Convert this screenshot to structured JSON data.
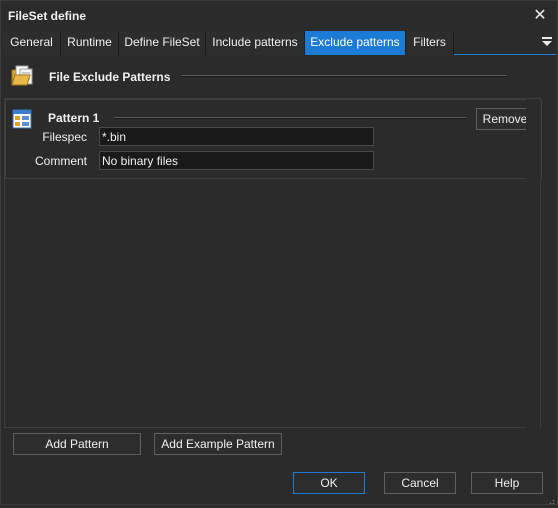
{
  "window": {
    "title": "FileSet define"
  },
  "tabs": [
    {
      "label": "General",
      "active": false
    },
    {
      "label": "Runtime",
      "active": false
    },
    {
      "label": "Define FileSet",
      "active": false
    },
    {
      "label": "Include patterns",
      "active": false
    },
    {
      "label": "Exclude patterns",
      "active": true
    },
    {
      "label": "Filters",
      "active": false
    }
  ],
  "section": {
    "title": "File Exclude Patterns",
    "icon": "folder-documents-icon"
  },
  "patterns": [
    {
      "title": "Pattern 1",
      "icon": "pattern-list-icon",
      "remove_label": "Remove",
      "filespec_label": "Filespec",
      "filespec_value": "*.bin",
      "comment_label": "Comment",
      "comment_value": "No binary files"
    }
  ],
  "actions": {
    "add_pattern": "Add Pattern",
    "add_example_pattern": "Add Example Pattern"
  },
  "footer": {
    "ok": "OK",
    "cancel": "Cancel",
    "help": "Help"
  },
  "colors": {
    "accent": "#1c7cd5",
    "background": "#2b2b2b",
    "input_bg": "#1a1a1a"
  }
}
